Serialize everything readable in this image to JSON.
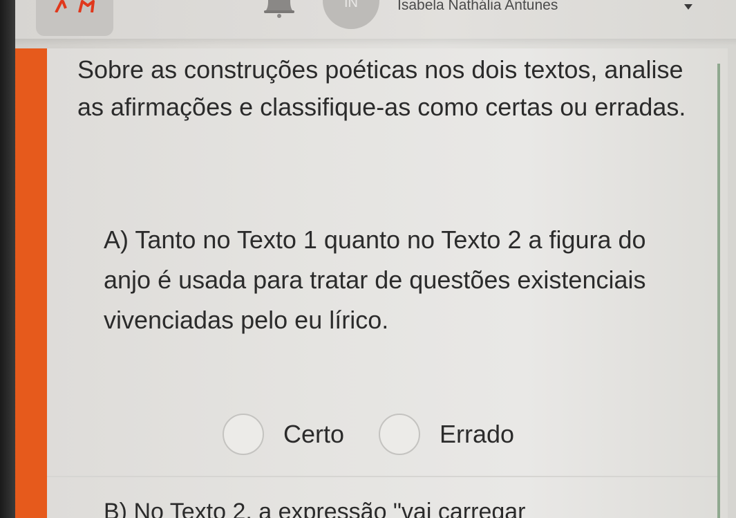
{
  "header": {
    "user_name": "Isabela Nathália Antunes",
    "avatar_initials": "IN"
  },
  "question": {
    "prompt": "Sobre as construções poéticas nos dois textos, analise as afirmações e classifique-as como certas ou erradas.",
    "statements": [
      {
        "text": "A) Tanto no Texto 1 quanto no Texto 2 a figura do anjo é usada para tratar de questões existenciais vivenciadas pelo eu lírico.",
        "options": [
          "Certo",
          "Errado"
        ]
      },
      {
        "text": "B) No Texto 2, a expressão \"vai carregar"
      }
    ]
  },
  "colors": {
    "accent": "#e65a1c",
    "side_line": "#8fa88f",
    "text": "#2b2b2b"
  }
}
